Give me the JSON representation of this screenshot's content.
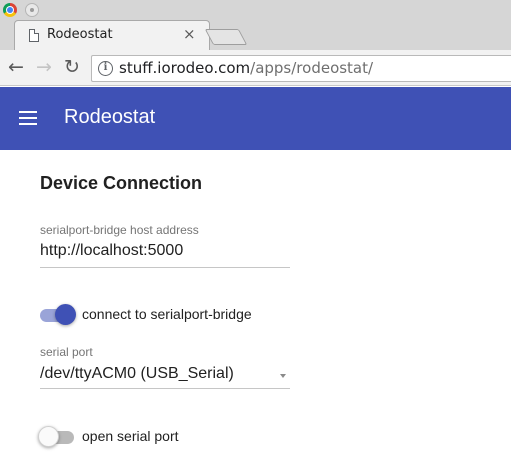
{
  "browser": {
    "tab": {
      "title": "Rodeostat",
      "close_glyph": "×",
      "icon": "document-icon"
    },
    "nav": {
      "back_glyph": "←",
      "forward_glyph": "→",
      "reload_glyph": "↻"
    },
    "address_bar": {
      "host": "stuff.iorodeo.com",
      "path": "/apps/rodeostat/",
      "icon": "info-icon"
    }
  },
  "appbar": {
    "title": "Rodeostat",
    "menu_icon": "menu-icon",
    "color": "#3f51b5"
  },
  "device_connection": {
    "heading": "Device Connection",
    "host_field": {
      "label": "serialport-bridge host address",
      "value": "http://localhost:5000"
    },
    "bridge_toggle": {
      "label": "connect to serialport-bridge",
      "checked": true
    },
    "serial_port": {
      "label": "serial port",
      "selected": "/dev/ttyACM0 (USB_Serial)"
    },
    "open_port_toggle": {
      "label": "open serial port",
      "checked": false
    }
  }
}
